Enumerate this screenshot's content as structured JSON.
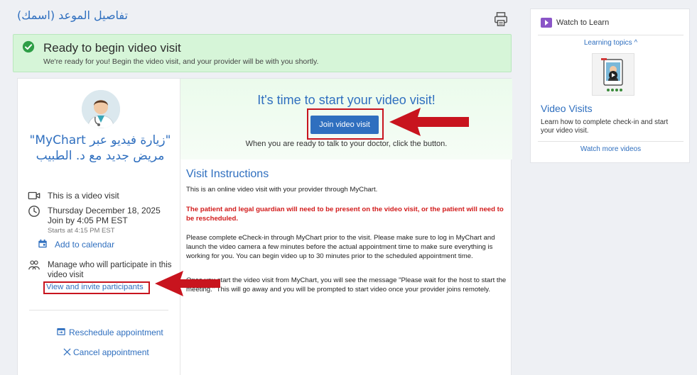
{
  "header": {
    "title": "تفاصيل الموعد (اسمك)",
    "print_icon": "printer-icon"
  },
  "banner": {
    "title": "Ready to begin video visit",
    "subtitle": "We're ready for you! Begin the video visit, and your provider will be with you shortly.",
    "icon": "check-circle-icon",
    "color": "#d6f5d8"
  },
  "visit": {
    "type_line1": "\"زيارة فيديو عبر MyChart\"",
    "type_line2": "مريض جديد مع د. الطبيب",
    "video_label": "This is a video visit",
    "date": "Thursday December 18, 2025",
    "join_by": "Join by 4:05 PM EST",
    "starts_at": "Starts at 4:15 PM EST",
    "add_calendar": "Add to calendar",
    "manage_line1": "Manage who will participate in this",
    "manage_line2": "video visit",
    "view_invite": "View and invite participants",
    "reschedule": "Reschedule appointment",
    "cancel": "Cancel appointment"
  },
  "hero": {
    "title": "It's time to start your video visit!",
    "join_button": "Join video visit",
    "subtitle": "When you are ready to talk to your doctor, click the button."
  },
  "instructions": {
    "title": "Visit Instructions",
    "p1": "This is an online video visit with your provider through MyChart.",
    "p2": "The patient and legal guardian will need to be present on the video visit, or the patient will need to be rescheduled.",
    "p3": "Please complete eCheck-in through MyChart prior to the visit. Please make sure to log in MyChart and launch the video camera a few minutes before the actual appointment time to make sure everything is working for you. You can begin video up to 30 minutes prior to the scheduled appointment time.",
    "p4": "Once you start the video visit from MyChart, you will see the message \"Please wait for the host to start the meeting.\" This will go away and you will be prompted to start video once your provider joins remotely."
  },
  "sidebar": {
    "header": "Watch to Learn",
    "topics": "Learning topics ^",
    "video_title": "Video Visits",
    "video_desc": "Learn how to complete check-in and start your video visit.",
    "more": "Watch more videos"
  },
  "colors": {
    "accent": "#2f6fbf",
    "highlight": "#c8141e",
    "warning": "#d21b1b"
  }
}
